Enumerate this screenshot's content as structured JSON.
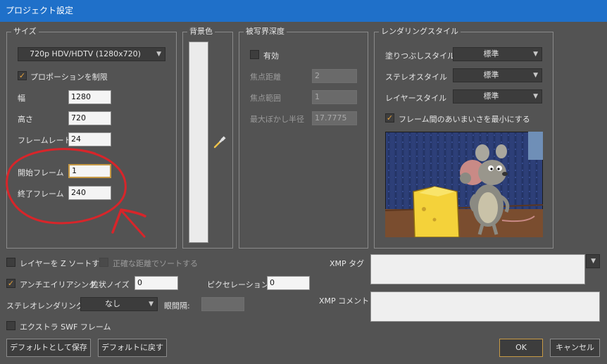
{
  "window": {
    "title": "プロジェクト設定"
  },
  "size": {
    "title": "サイズ",
    "preset": "720p HDV/HDTV (1280x720)",
    "constrain_label": "プロポーションを制限",
    "constrain_checked": true,
    "width_label": "幅",
    "width_value": "1280",
    "height_label": "高さ",
    "height_value": "720",
    "framerate_label": "フレームレート",
    "framerate_value": "24",
    "start_label": "開始フレーム",
    "start_value": "1",
    "end_label": "終了フレーム",
    "end_value": "240"
  },
  "background": {
    "title": "背景色",
    "color": "#ebebeb"
  },
  "dof": {
    "title": "被写界深度",
    "enabled_label": "有効",
    "enabled_checked": false,
    "focus_distance_label": "焦点距離",
    "focus_distance_value": "2",
    "focus_range_label": "焦点範囲",
    "focus_range_value": "1",
    "max_blur_label": "最大ぼかし半径",
    "max_blur_value": "17.7775"
  },
  "render_style": {
    "title": "レンダリングスタイル",
    "fill_label": "塗りつぶしスタイル",
    "fill_value": "標準",
    "stereo_label": "ステレオスタイル",
    "stereo_value": "標準",
    "layer_label": "レイヤースタイル",
    "layer_value": "標準",
    "minimize_label": "フレーム間のあいまいさを最小にする",
    "minimize_checked": true
  },
  "options": {
    "zsort_label": "レイヤーを Z ソートする",
    "zsort_checked": false,
    "exact_label": "正確な距離でソートする",
    "exact_checked": false,
    "antialias_label": "アンチエイリアシング",
    "antialias_checked": true,
    "grain_label": "粒状ノイズ",
    "grain_value": "0",
    "pixelation_label": "ピクセレーション",
    "pixelation_value": "0",
    "stereo_render_label": "ステレオレンダリング:",
    "stereo_render_value": "なし",
    "eye_label": "眼間隔:",
    "eye_value": "",
    "extra_swf_label": "エクストラ SWF フレーム",
    "extra_swf_checked": false
  },
  "xmp": {
    "tag_label": "XMP タグ",
    "comment_label": "XMP コメント"
  },
  "buttons": {
    "save_default": "デフォルトとして保存",
    "reset_default": "デフォルトに戻す",
    "ok": "OK",
    "cancel": "キャンセル"
  },
  "colors": {
    "accent": "#1f70c9",
    "focus": "#c79a45",
    "annotation": "#d8252a",
    "check": "#e8a33d"
  },
  "icons": {
    "dropdown": "chevron-down-icon",
    "picker": "eyedropper-icon",
    "check": "checkmark-icon"
  }
}
